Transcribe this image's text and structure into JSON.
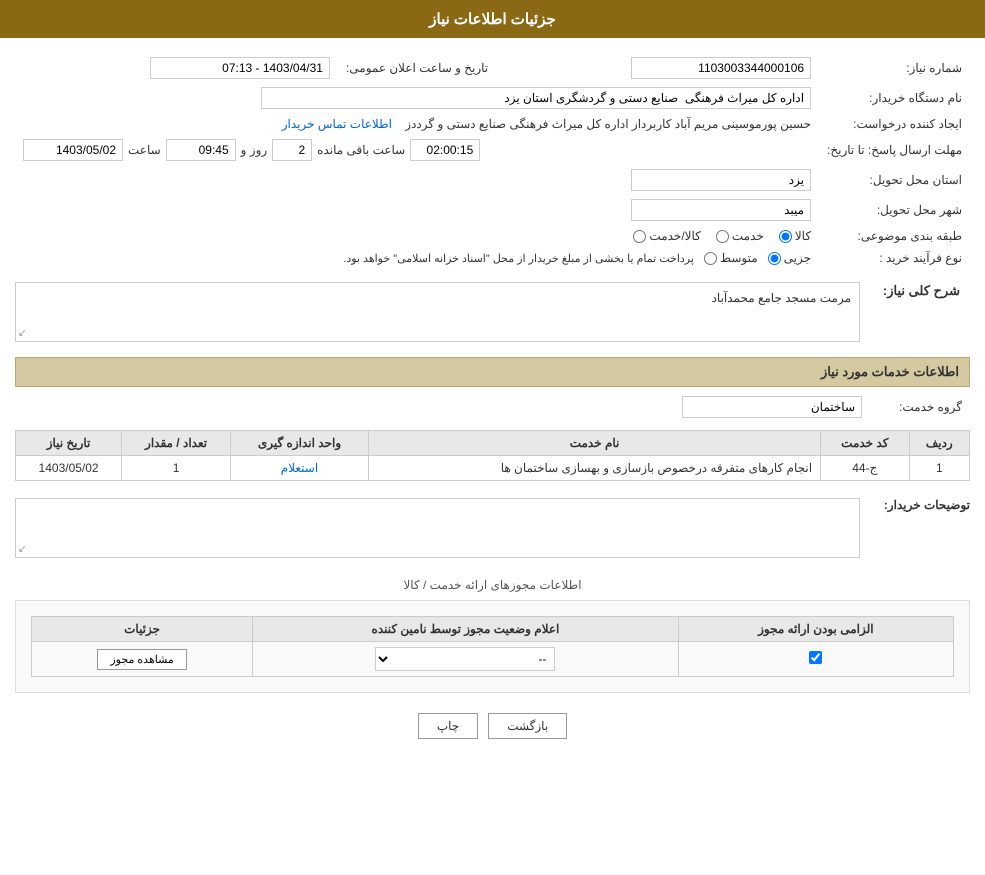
{
  "page": {
    "title": "جزئیات اطلاعات نیاز",
    "sections": {
      "main_info": "اطلاعات نیاز",
      "service_info": "اطلاعات خدمات مورد نیاز",
      "description_label": "شرح کلی نیاز:",
      "service_group_label": "گروه خدمت:",
      "buyer_notes_label": "توضیحات خریدار:",
      "licenses_header": "اطلاعات مجوزهای ارائه خدمت / کالا"
    },
    "fields": {
      "need_number_label": "شماره نیاز:",
      "need_number_value": "1103003344000106",
      "buyer_org_label": "نام دستگاه خریدار:",
      "buyer_org_value": "اداره کل میراث فرهنگی  صنایع دستی و گردشگری استان یزد",
      "creator_label": "ایجاد کننده درخواست:",
      "creator_value": "حسین پورموسینی مریم آباد کاربرداز اداره کل میراث فرهنگی  صنایع دستی و گرددز",
      "contact_link": "اطلاعات تماس خریدار",
      "deadline_label": "مهلت ارسال پاسخ: تا تاریخ:",
      "deadline_date": "1403/05/02",
      "deadline_time_label": "ساعت",
      "deadline_time": "09:45",
      "remaining_days_label": "روز و",
      "remaining_days": "2",
      "remaining_time_label": "ساعت باقی مانده",
      "remaining_time": "02:00:15",
      "province_label": "استان محل تحویل:",
      "province_value": "یزد",
      "city_label": "شهر محل تحویل:",
      "city_value": "میبد",
      "category_label": "طبقه بندی موضوعی:",
      "category_options": [
        "کالا",
        "خدمت",
        "کالا/خدمت"
      ],
      "category_selected": "کالا",
      "purchase_type_label": "نوع فرآیند خرید :",
      "purchase_type_options": [
        "جزیی",
        "متوسط"
      ],
      "purchase_type_selected": "جزیی",
      "purchase_type_note": "پرداخت تمام یا بخشی از مبلغ خریدار از محل \"اسناد خزانه اسلامی\" خواهد بود.",
      "date_label": "تاریخ و ساعت اعلان عمومی:",
      "date_value": "1403/04/31 - 07:13"
    },
    "description_text": "مرمت مسجد جامع محمدآباد",
    "service_group_value": "ساختمان",
    "services_table": {
      "headers": [
        "ردیف",
        "کد خدمت",
        "نام خدمت",
        "واحد اندازه گیری",
        "تعداد / مقدار",
        "تاریخ نیاز"
      ],
      "rows": [
        {
          "row": "1",
          "code": "ج-44",
          "name": "انجام کارهای متفرقه درخصوص بازسازی و بهسازی ساختمان ها",
          "unit": "استعلام",
          "quantity": "1",
          "date": "1403/05/02"
        }
      ]
    },
    "licenses_table": {
      "headers": [
        "الزامی بودن ارائه مجوز",
        "اعلام وضعیت مجوز توسط نامین کننده",
        "جزئیات"
      ],
      "rows": [
        {
          "required": true,
          "status": "--",
          "details_btn": "مشاهده مجوز"
        }
      ]
    },
    "buttons": {
      "print": "چاپ",
      "back": "بازگشت"
    }
  }
}
